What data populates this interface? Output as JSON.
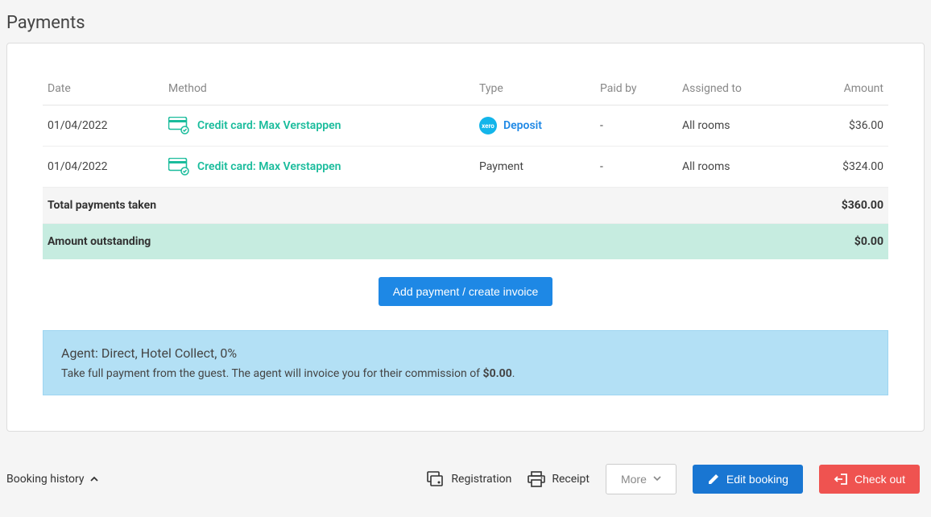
{
  "section": {
    "title": "Payments"
  },
  "table": {
    "headers": {
      "date": "Date",
      "method": "Method",
      "type": "Type",
      "paidby": "Paid by",
      "assigned": "Assigned to",
      "amount": "Amount"
    },
    "rows": [
      {
        "date": "01/04/2022",
        "method": "Credit card: Max Verstappen",
        "type": "Deposit",
        "type_is_link": true,
        "xero": true,
        "paidby": "-",
        "assigned": "All rooms",
        "amount": "$36.00"
      },
      {
        "date": "01/04/2022",
        "method": "Credit card: Max Verstappen",
        "type": "Payment",
        "type_is_link": false,
        "xero": false,
        "paidby": "-",
        "assigned": "All rooms",
        "amount": "$324.00"
      }
    ],
    "total": {
      "label": "Total payments taken",
      "amount": "$360.00"
    },
    "outstanding": {
      "label": "Amount outstanding",
      "amount": "$0.00"
    }
  },
  "buttons": {
    "addpayment": "Add payment / create invoice"
  },
  "info": {
    "title": "Agent: Direct, Hotel Collect, 0%",
    "body_prefix": "Take full payment from the guest. The agent will invoice you for their commission of ",
    "body_strong": "$0.00",
    "body_suffix": "."
  },
  "footer": {
    "history": "Booking history",
    "registration": "Registration",
    "receipt": "Receipt",
    "more": "More",
    "edit": "Edit booking",
    "checkout": "Check out"
  },
  "icons": {
    "xero_label": "xero"
  }
}
